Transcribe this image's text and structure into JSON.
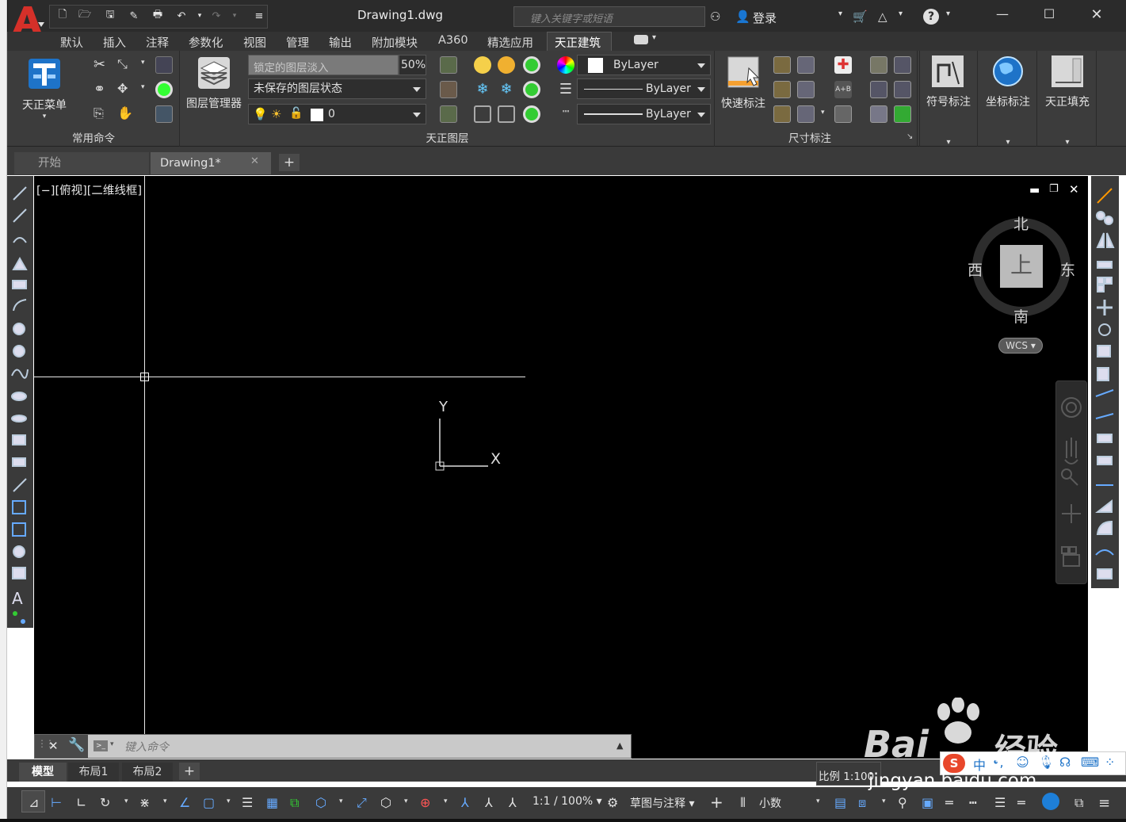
{
  "window": {
    "title": "Drawing1.dwg",
    "login": "登录",
    "search_placeholder": "键入关键字或短语"
  },
  "app_menu": {
    "letter": "A"
  },
  "menu_tabs": [
    "默认",
    "插入",
    "注释",
    "参数化",
    "视图",
    "管理",
    "输出",
    "附加模块",
    "A360",
    "精选应用",
    "天正建筑"
  ],
  "active_tab": "天正建筑",
  "ribbon": {
    "panel_common": {
      "title": "常用命令",
      "big_button": "天正菜单"
    },
    "panel_layer": {
      "title": "天正图层",
      "big_button": "图层管理器",
      "layer_fade_label": "锁定的图层淡入",
      "layer_fade_value": "50%",
      "layer_state": "未保存的图层状态",
      "current_layer": "0",
      "color": "ByLayer",
      "linetype": "ByLayer",
      "lineweight": "ByLayer"
    },
    "panel_dim": {
      "title": "尺寸标注",
      "big_button": "快速标注"
    },
    "panel_symbol": {
      "label": "符号标注"
    },
    "panel_coord": {
      "label": "坐标标注"
    },
    "panel_fill": {
      "label": "天正填充"
    }
  },
  "file_tabs": [
    {
      "label": "开始"
    },
    {
      "label": "Drawing1*"
    }
  ],
  "viewport": {
    "label": "[−][俯视][二维线框]",
    "ucs_x": "X",
    "ucs_y": "Y"
  },
  "viewcube": {
    "face": "上",
    "north": "北",
    "south": "南",
    "east": "东",
    "west": "西",
    "wcs": "WCS"
  },
  "command": {
    "placeholder": "键入命令"
  },
  "layout_tabs": [
    "模型",
    "布局1",
    "布局2"
  ],
  "status": {
    "scale": "1:1 / 100%",
    "workspace": "草图与注释",
    "units": "小数",
    "annotation_scale": "比例 1:100"
  },
  "watermark": {
    "line1": "Bai",
    "line2": "经验",
    "url": "jingyan.baidu.com"
  },
  "colors": {
    "accent": "#d53029",
    "canvas": "#000000",
    "ribbon": "#3c3c3c",
    "active_blue": "#1e90ff"
  }
}
